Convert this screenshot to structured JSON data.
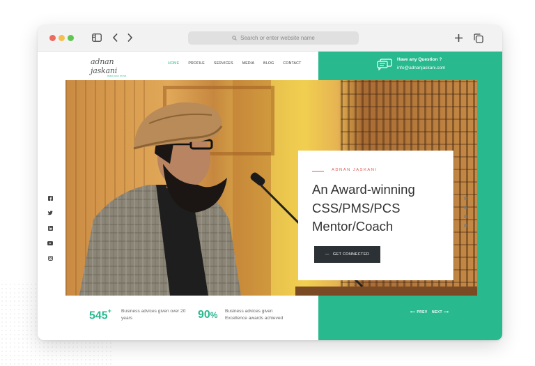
{
  "browser": {
    "address_placeholder": "Search or enter website name"
  },
  "site": {
    "logo_text": "adnan jaskani",
    "logo_tagline": "lead your mind",
    "nav": [
      "HOME",
      "PROFILE",
      "SERVICES",
      "MEDIA",
      "BLOG",
      "CONTACT"
    ],
    "nav_active": "HOME",
    "question_title": "Have any Question ?",
    "question_email": "info@adnanjaskani.com"
  },
  "hero": {
    "overline": "ADNAN JASKANI",
    "headline_lines": [
      "An Award-winning",
      "CSS/PMS/PCS",
      "Mentor/Coach"
    ],
    "cta_label": "GET CONNECTED",
    "social_icons": [
      "facebook-icon",
      "twitter-icon",
      "linkedin-icon",
      "youtube-icon",
      "instagram-icon"
    ]
  },
  "stats": [
    {
      "number": "545",
      "suffix": "+",
      "text_lines": [
        "Business advices given over 20",
        "years"
      ]
    },
    {
      "number": "90",
      "suffix": "%",
      "text_lines": [
        "Business advices given",
        "Excellence awards achieved"
      ]
    }
  ],
  "pager": {
    "prev": "PREV",
    "next": "NEXT"
  },
  "colors": {
    "accent": "#28b98f",
    "dark": "#2b3134",
    "red": "#e0574f"
  }
}
